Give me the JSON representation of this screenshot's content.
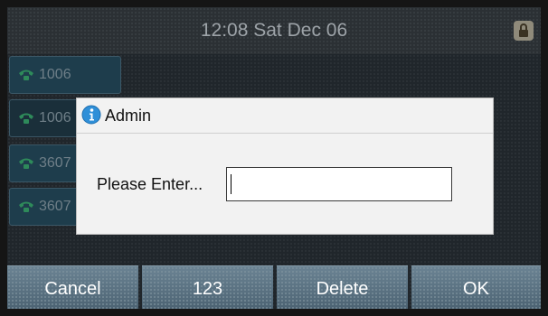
{
  "statusbar": {
    "clock": "12:08 Sat Dec 06",
    "lock_icon": "lock-icon"
  },
  "line_keys": [
    {
      "label": "1006",
      "icon": "phone-icon"
    },
    {
      "label": "1006",
      "icon": "phone-icon"
    },
    {
      "label": "3607",
      "icon": "phone-icon"
    },
    {
      "label": "3607",
      "icon": "phone-icon"
    }
  ],
  "dialog": {
    "title": "Admin",
    "title_icon": "info-icon",
    "prompt": "Please Enter...",
    "input_value": ""
  },
  "softkeys": [
    {
      "label": "Cancel"
    },
    {
      "label": "123"
    },
    {
      "label": "Delete"
    },
    {
      "label": "OK"
    }
  ],
  "colors": {
    "accent_blue": "#2f8fd8",
    "softkey_bg": "#5a7383",
    "line_icon_green": "#2e8a5a"
  }
}
